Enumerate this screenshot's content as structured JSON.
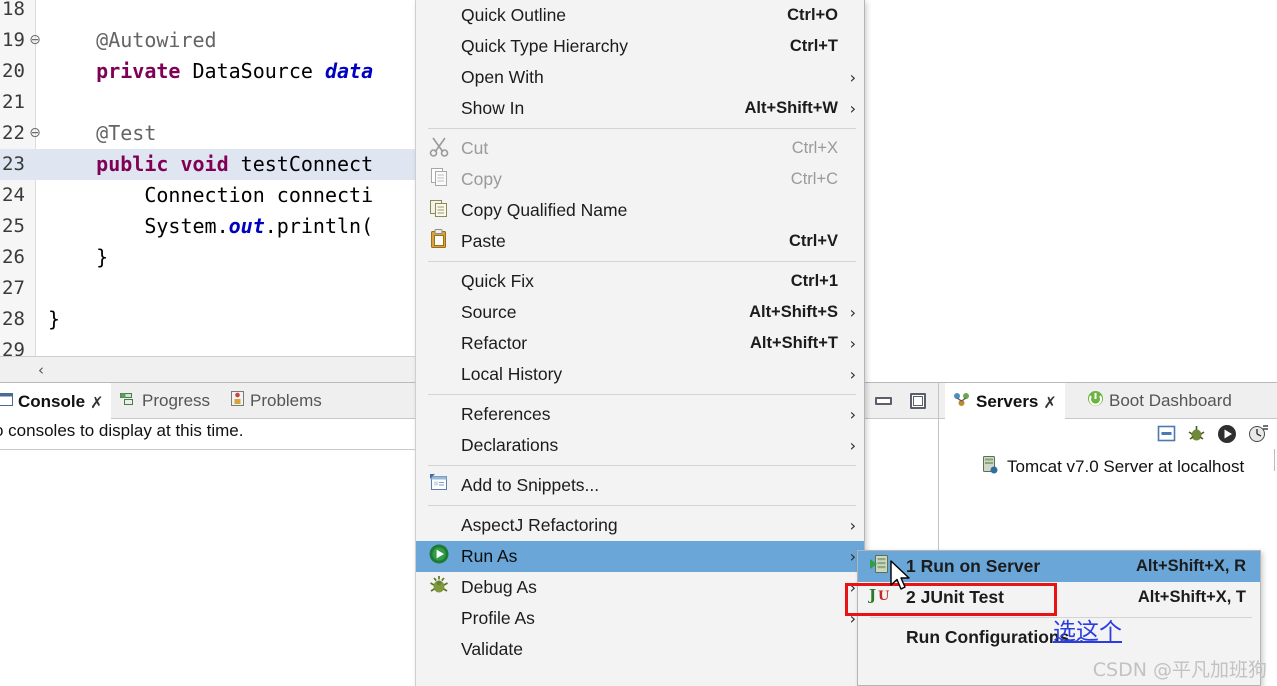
{
  "editor": {
    "lines": [
      {
        "no": "18",
        "fold": "",
        "segments": [],
        "highlight": false
      },
      {
        "no": "19",
        "fold": "⊖",
        "segments": [
          {
            "t": "    @Autowired",
            "c": "ann"
          }
        ],
        "highlight": false
      },
      {
        "no": "20",
        "fold": "",
        "segments": [
          {
            "t": "    private ",
            "c": "kw"
          },
          {
            "t": "DataSource ",
            "c": "plain"
          },
          {
            "t": "data",
            "c": "fld"
          }
        ],
        "highlight": false
      },
      {
        "no": "21",
        "fold": "",
        "segments": [],
        "highlight": false
      },
      {
        "no": "22",
        "fold": "⊖",
        "segments": [
          {
            "t": "    @Test",
            "c": "ann"
          }
        ],
        "highlight": false
      },
      {
        "no": "23",
        "fold": "",
        "segments": [
          {
            "t": "    public void ",
            "c": "kw"
          },
          {
            "t": "testConnect",
            "c": "plain"
          }
        ],
        "highlight": true
      },
      {
        "no": "24",
        "fold": "",
        "segments": [
          {
            "t": "        Connection connecti",
            "c": "plain"
          }
        ],
        "highlight": false
      },
      {
        "no": "25",
        "fold": "",
        "segments": [
          {
            "t": "        System.",
            "c": "plain"
          },
          {
            "t": "out",
            "c": "fld"
          },
          {
            "t": ".println(",
            "c": "plain"
          }
        ],
        "highlight": false
      },
      {
        "no": "26",
        "fold": "",
        "segments": [
          {
            "t": "    }",
            "c": "plain"
          }
        ],
        "highlight": false
      },
      {
        "no": "27",
        "fold": "",
        "segments": [],
        "highlight": false
      },
      {
        "no": "28",
        "fold": "",
        "segments": [
          {
            "t": "}",
            "c": "plain"
          }
        ],
        "highlight": false
      },
      {
        "no": "29",
        "fold": "",
        "segments": [],
        "highlight": false
      }
    ],
    "scroll_left_glyph": "‹"
  },
  "console": {
    "tabs": [
      {
        "label": "Console",
        "active": true,
        "closable": true,
        "icon": "console-icon"
      },
      {
        "label": "Progress",
        "active": false,
        "closable": false,
        "icon": "progress-icon"
      },
      {
        "label": "Problems",
        "active": false,
        "closable": false,
        "icon": "problems-icon"
      }
    ],
    "message": "o consoles to display at this time.",
    "close_glyph": "✗",
    "minimize_title": "Minimize",
    "maximize_title": "Maximize"
  },
  "servers": {
    "tabs": [
      {
        "label": "Servers",
        "active": true,
        "closable": true,
        "icon": "servers-icon"
      },
      {
        "label": "Boot Dashboard",
        "active": false,
        "closable": false,
        "icon": "boot-dashboard-icon"
      }
    ],
    "close_glyph": "✗",
    "toolbar_icons": [
      "stop-icon",
      "debug-icon",
      "start-icon",
      "profile-icon"
    ],
    "tree_item": "Tomcat v7.0 Server at localhost"
  },
  "context_menu": {
    "items": [
      {
        "label": "Quick Outline",
        "accel": "Ctrl+O",
        "arrow": false,
        "icon": null,
        "state": "normal",
        "sep_after": false
      },
      {
        "label": "Quick Type Hierarchy",
        "accel": "Ctrl+T",
        "arrow": false,
        "icon": null,
        "state": "normal",
        "sep_after": false
      },
      {
        "label": "Open With",
        "accel": "",
        "arrow": true,
        "icon": null,
        "state": "normal",
        "sep_after": false
      },
      {
        "label": "Show In",
        "accel": "Alt+Shift+W",
        "arrow": true,
        "icon": null,
        "state": "normal",
        "sep_after": true
      },
      {
        "label": "Cut",
        "accel": "Ctrl+X",
        "arrow": false,
        "icon": "cut-icon",
        "state": "disabled",
        "sep_after": false
      },
      {
        "label": "Copy",
        "accel": "Ctrl+C",
        "arrow": false,
        "icon": "copy-icon",
        "state": "disabled",
        "sep_after": false
      },
      {
        "label": "Copy Qualified Name",
        "accel": "",
        "arrow": false,
        "icon": "copy-qualified-icon",
        "state": "normal",
        "sep_after": false
      },
      {
        "label": "Paste",
        "accel": "Ctrl+V",
        "arrow": false,
        "icon": "paste-icon",
        "state": "normal",
        "sep_after": true
      },
      {
        "label": "Quick Fix",
        "accel": "Ctrl+1",
        "arrow": false,
        "icon": null,
        "state": "normal",
        "sep_after": false
      },
      {
        "label": "Source",
        "accel": "Alt+Shift+S",
        "arrow": true,
        "icon": null,
        "state": "normal",
        "sep_after": false
      },
      {
        "label": "Refactor",
        "accel": "Alt+Shift+T",
        "arrow": true,
        "icon": null,
        "state": "normal",
        "sep_after": false
      },
      {
        "label": "Local History",
        "accel": "",
        "arrow": true,
        "icon": null,
        "state": "normal",
        "sep_after": true
      },
      {
        "label": "References",
        "accel": "",
        "arrow": true,
        "icon": null,
        "state": "normal",
        "sep_after": false
      },
      {
        "label": "Declarations",
        "accel": "",
        "arrow": true,
        "icon": null,
        "state": "normal",
        "sep_after": true
      },
      {
        "label": "Add to Snippets...",
        "accel": "",
        "arrow": false,
        "icon": "snippets-icon",
        "state": "normal",
        "sep_after": true
      },
      {
        "label": "AspectJ Refactoring",
        "accel": "",
        "arrow": true,
        "icon": null,
        "state": "normal",
        "sep_after": false
      },
      {
        "label": "Run As",
        "accel": "",
        "arrow": true,
        "icon": "run-icon",
        "state": "selected",
        "sep_after": false
      },
      {
        "label": "Debug As",
        "accel": "",
        "arrow": true,
        "icon": "debug-icon",
        "state": "normal",
        "sep_after": false
      },
      {
        "label": "Profile As",
        "accel": "",
        "arrow": true,
        "icon": null,
        "state": "normal",
        "sep_after": false
      },
      {
        "label": "Validate",
        "accel": "",
        "arrow": false,
        "icon": null,
        "state": "normal",
        "sep_after": false
      }
    ],
    "arrow_glyph": "›"
  },
  "submenu": {
    "items": [
      {
        "label": "1 Run on Server",
        "accel": "Alt+Shift+X, R",
        "icon": "run-on-server-icon",
        "state": "selected",
        "sep_after": false
      },
      {
        "label": "2 JUnit Test",
        "accel": "Alt+Shift+X, T",
        "icon": "junit-icon",
        "state": "normal",
        "sep_after": true
      },
      {
        "label": "Run Configurations...",
        "accel": "",
        "icon": null,
        "state": "normal",
        "sep_after": false
      }
    ]
  },
  "annotations": {
    "note": "选这个",
    "note_color": "#2b3de0",
    "highlight_box_color": "#e81313"
  },
  "watermark": {
    "text": "CSDN @平凡加班狗"
  },
  "colors": {
    "menu_bg": "#f3f3f3",
    "selection": "#6aa7d8",
    "editor_line_highlight": "#dfe6f2",
    "keyword": "#7f0055",
    "field": "#0000c0",
    "annotation": "#646464"
  }
}
